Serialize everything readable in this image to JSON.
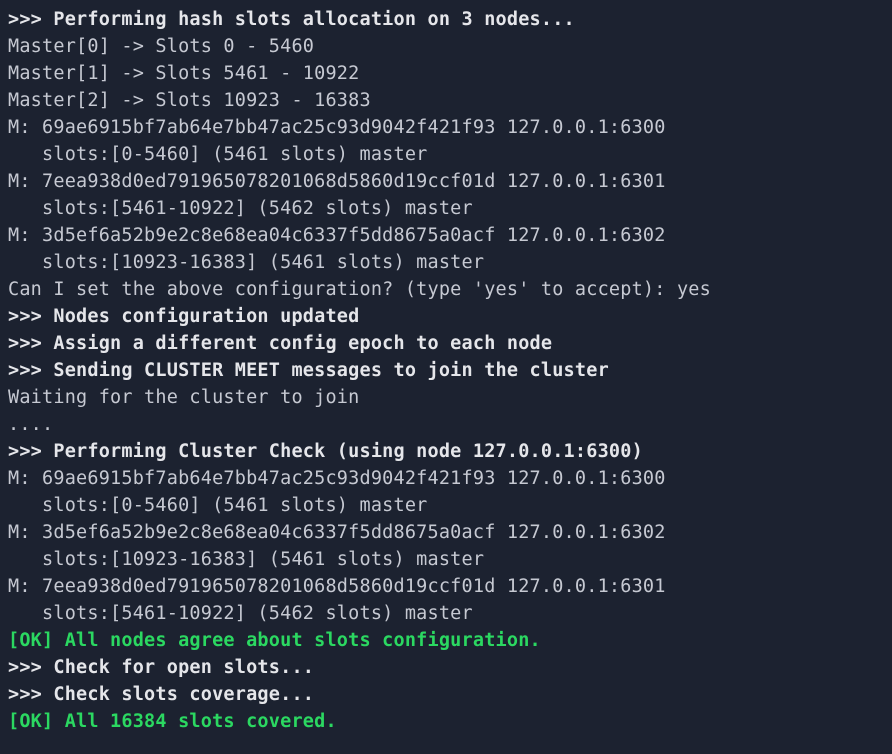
{
  "colors": {
    "bg": "#1c2230",
    "fg_dim": "#c6c9d2",
    "fg_bold": "#e5e6ea",
    "ok_green": "#2bd861"
  },
  "lines": [
    {
      "cls": "bold",
      "text": ">>> Performing hash slots allocation on 3 nodes..."
    },
    {
      "cls": "",
      "text": "Master[0] -> Slots 0 - 5460"
    },
    {
      "cls": "",
      "text": "Master[1] -> Slots 5461 - 10922"
    },
    {
      "cls": "",
      "text": "Master[2] -> Slots 10923 - 16383"
    },
    {
      "cls": "",
      "text": "M: 69ae6915bf7ab64e7bb47ac25c93d9042f421f93 127.0.0.1:6300"
    },
    {
      "cls": "",
      "text": "   slots:[0-5460] (5461 slots) master"
    },
    {
      "cls": "",
      "text": "M: 7eea938d0ed791965078201068d5860d19ccf01d 127.0.0.1:6301"
    },
    {
      "cls": "",
      "text": "   slots:[5461-10922] (5462 slots) master"
    },
    {
      "cls": "",
      "text": "M: 3d5ef6a52b9e2c8e68ea04c6337f5dd8675a0acf 127.0.0.1:6302"
    },
    {
      "cls": "",
      "text": "   slots:[10923-16383] (5461 slots) master"
    },
    {
      "cls": "",
      "text": "Can I set the above configuration? (type 'yes' to accept): yes"
    },
    {
      "cls": "bold",
      "text": ">>> Nodes configuration updated"
    },
    {
      "cls": "bold",
      "text": ">>> Assign a different config epoch to each node"
    },
    {
      "cls": "bold",
      "text": ">>> Sending CLUSTER MEET messages to join the cluster"
    },
    {
      "cls": "",
      "text": "Waiting for the cluster to join"
    },
    {
      "cls": "",
      "text": "...."
    },
    {
      "cls": "bold",
      "text": ">>> Performing Cluster Check (using node 127.0.0.1:6300)"
    },
    {
      "cls": "",
      "text": "M: 69ae6915bf7ab64e7bb47ac25c93d9042f421f93 127.0.0.1:6300"
    },
    {
      "cls": "",
      "text": "   slots:[0-5460] (5461 slots) master"
    },
    {
      "cls": "",
      "text": "M: 3d5ef6a52b9e2c8e68ea04c6337f5dd8675a0acf 127.0.0.1:6302"
    },
    {
      "cls": "",
      "text": "   slots:[10923-16383] (5461 slots) master"
    },
    {
      "cls": "",
      "text": "M: 7eea938d0ed791965078201068d5860d19ccf01d 127.0.0.1:6301"
    },
    {
      "cls": "",
      "text": "   slots:[5461-10922] (5462 slots) master"
    },
    {
      "cls": "ok",
      "text": "[OK] All nodes agree about slots configuration."
    },
    {
      "cls": "bold",
      "text": ">>> Check for open slots..."
    },
    {
      "cls": "bold",
      "text": ">>> Check slots coverage..."
    },
    {
      "cls": "ok",
      "text": "[OK] All 16384 slots covered."
    }
  ]
}
